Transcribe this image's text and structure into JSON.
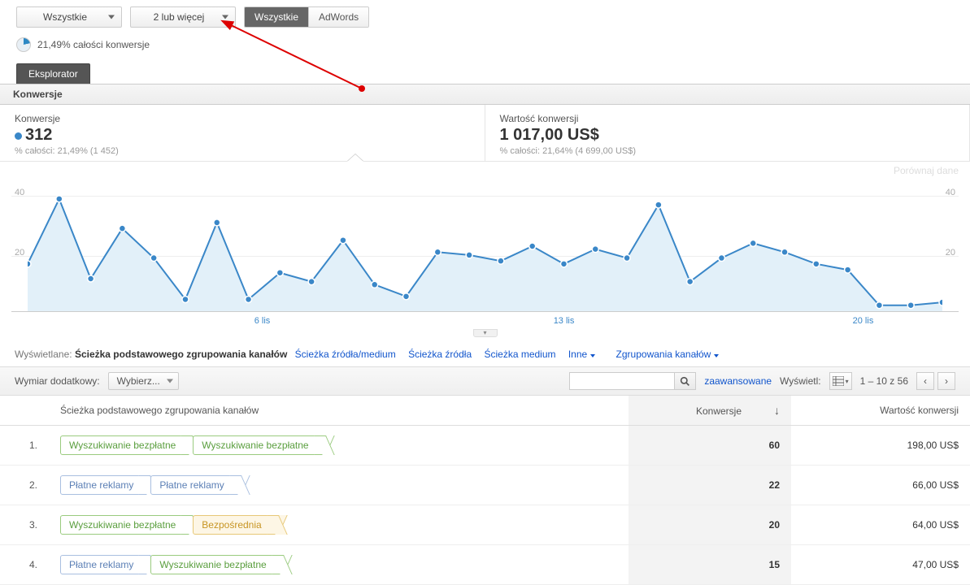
{
  "controls": {
    "dd1": "Wszystkie",
    "dd2": "2 lub więcej",
    "seg_active": "Wszystkie",
    "seg_other": "AdWords"
  },
  "percent_note": "21,49% całości konwersje",
  "tab": "Eksplorator",
  "sub_tab": "Konwersje",
  "metrics": {
    "left_title": "Konwersje",
    "left_value": "312",
    "left_note": "% całości: 21,49% (1 452)",
    "right_title": "Wartość konwersji",
    "right_value": "1 017,00 US$",
    "right_note": "% całości: 21,64% (4 699,00 US$)"
  },
  "compare_label": "Porównaj dane",
  "chart_data": {
    "type": "area",
    "ylabel": "",
    "ylim": [
      0,
      44
    ],
    "y_ticks": [
      20,
      40
    ],
    "x_ticks": [
      {
        "label": "6 lis",
        "pos": 0.25
      },
      {
        "label": "13 lis",
        "pos": 0.58
      },
      {
        "label": "20 lis",
        "pos": 0.91
      }
    ],
    "values": [
      16,
      38,
      11,
      28,
      18,
      4,
      30,
      4,
      13,
      10,
      24,
      9,
      5,
      20,
      19,
      17,
      22,
      16,
      21,
      18,
      36,
      10,
      18,
      23,
      20,
      16,
      14,
      2,
      2,
      3
    ]
  },
  "dim_bar": {
    "label": "Wyświetlane:",
    "active": "Ścieżka podstawowego zgrupowania kanałów",
    "links": [
      "Ścieżka źródła/medium",
      "Ścieżka źródła",
      "Ścieżka medium",
      "Inne"
    ],
    "group_link": "Zgrupowania kanałów"
  },
  "filter": {
    "secondary_label": "Wymiar dodatkowy:",
    "secondary_value": "Wybierz...",
    "advanced": "zaawansowane",
    "view_label": "Wyświetl:",
    "range": "1 – 10 z 56"
  },
  "table": {
    "cols": {
      "path": "Ścieżka podstawowego zgrupowania kanałów",
      "conv": "Konwersje",
      "val": "Wartość konwersji"
    },
    "rows": [
      {
        "idx": "1.",
        "chips": [
          {
            "t": "organic",
            "l": "Wyszukiwanie bezpłatne"
          },
          {
            "t": "organic",
            "l": "Wyszukiwanie bezpłatne"
          }
        ],
        "conv": "60",
        "val": "198,00 US$"
      },
      {
        "idx": "2.",
        "chips": [
          {
            "t": "paid",
            "l": "Płatne reklamy"
          },
          {
            "t": "paid",
            "l": "Płatne reklamy"
          }
        ],
        "conv": "22",
        "val": "66,00 US$"
      },
      {
        "idx": "3.",
        "chips": [
          {
            "t": "organic",
            "l": "Wyszukiwanie bezpłatne"
          },
          {
            "t": "direct",
            "l": "Bezpośrednia"
          }
        ],
        "conv": "20",
        "val": "64,00 US$"
      },
      {
        "idx": "4.",
        "chips": [
          {
            "t": "paid",
            "l": "Płatne reklamy"
          },
          {
            "t": "organic",
            "l": "Wyszukiwanie bezpłatne"
          }
        ],
        "conv": "15",
        "val": "47,00 US$"
      }
    ]
  }
}
